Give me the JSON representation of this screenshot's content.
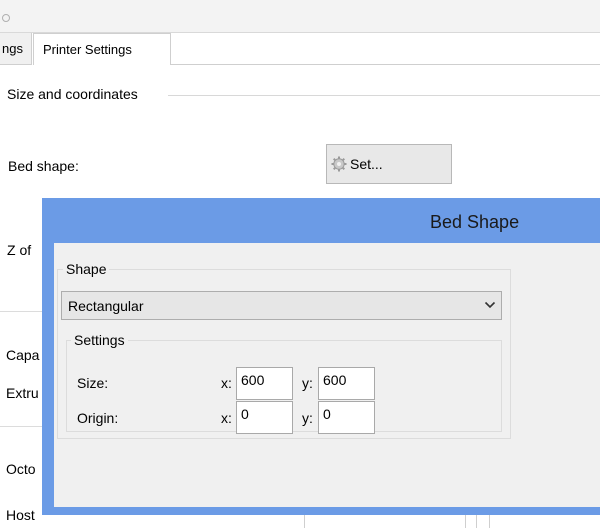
{
  "tabs": {
    "left_partial": "ngs",
    "active": "Printer Settings"
  },
  "group": {
    "title": "Size and coordinates"
  },
  "settings": {
    "bed_shape_label": "Bed shape:",
    "set_button_label": "Set...",
    "z_offset_label": "Z of",
    "capabilities_label": "Capa",
    "extruders_label": "Extru",
    "octoprint_label": "Octo",
    "host_label": "Host"
  },
  "dialog": {
    "title": "Bed Shape",
    "shape_legend": "Shape",
    "shape_value": "Rectangular",
    "settings_legend": "Settings",
    "size_label": "Size:",
    "origin_label": "Origin:",
    "x_prefix": "x:",
    "y_prefix": "y:",
    "size_x": "600",
    "size_y": "600",
    "origin_x": "0",
    "origin_y": "0"
  },
  "colors": {
    "dialog_frame": "#6b9be6",
    "dialog_body": "#f0f0f0"
  }
}
